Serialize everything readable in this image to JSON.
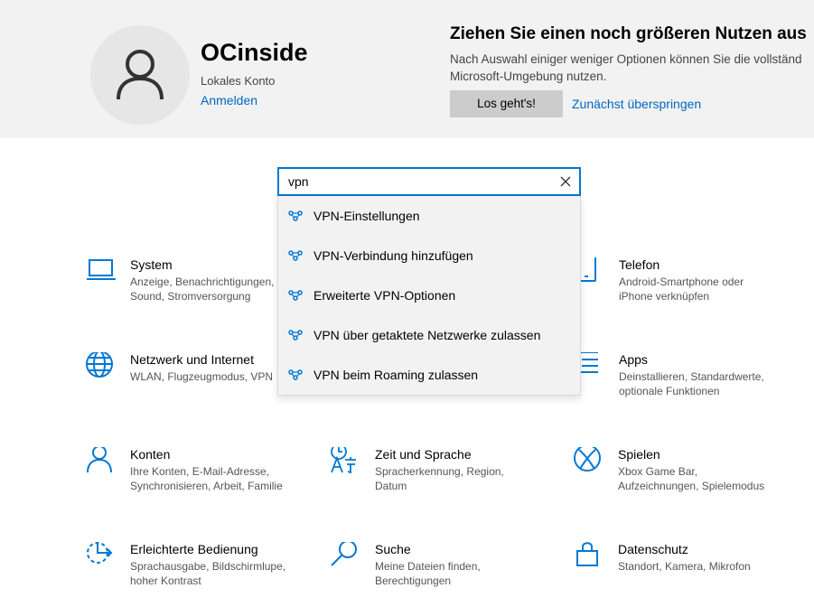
{
  "profile": {
    "name": "OCinside",
    "account_type": "Lokales Konto",
    "signin_label": "Anmelden"
  },
  "promo": {
    "title": "Ziehen Sie einen noch größeren Nutzen aus",
    "description_line1": "Nach Auswahl einiger weniger Optionen können Sie die vollständ",
    "description_line2": "Microsoft-Umgebung nutzen.",
    "button_label": "Los geht's!",
    "skip_label": "Zunächst überspringen"
  },
  "search": {
    "value": "vpn",
    "suggestions": [
      {
        "label": "VPN-Einstellungen"
      },
      {
        "label": "VPN-Verbindung hinzufügen"
      },
      {
        "label": "Erweiterte VPN-Optionen"
      },
      {
        "label": "VPN über getaktete Netzwerke zulassen"
      },
      {
        "label": "VPN beim Roaming zulassen"
      }
    ]
  },
  "categories": [
    {
      "title": "System",
      "desc1": "Anzeige, Benachrichtigungen,",
      "desc2": "Sound, Stromversorgung",
      "icon": "laptop-icon"
    },
    {
      "title": "Telefon",
      "desc1": "Android-Smartphone oder",
      "desc2": "iPhone verknüpfen",
      "icon": "phone-icon"
    },
    {
      "title": "Netzwerk und Internet",
      "desc1": "WLAN, Flugzeugmodus, VPN",
      "desc2": "",
      "icon": "globe-icon"
    },
    {
      "title": "Apps",
      "desc1": "Deinstallieren, Standardwerte,",
      "desc2": "optionale Funktionen",
      "icon": "apps-list-icon"
    },
    {
      "title": "Konten",
      "desc1": "Ihre Konten, E-Mail-Adresse,",
      "desc2": "Synchronisieren, Arbeit, Familie",
      "icon": "person-icon"
    },
    {
      "title": "Zeit und Sprache",
      "desc1": "Spracherkennung, Region,",
      "desc2": "Datum",
      "icon": "time-language-icon"
    },
    {
      "title": "Spielen",
      "desc1": "Xbox Game Bar,",
      "desc2": "Aufzeichnungen, Spielemodus",
      "icon": "xbox-icon"
    },
    {
      "title": "Erleichterte Bedienung",
      "desc1": "Sprachausgabe, Bildschirmlupe,",
      "desc2": "hoher Kontrast",
      "icon": "ease-of-access-icon"
    },
    {
      "title": "Suche",
      "desc1": "Meine Dateien finden,",
      "desc2": "Berechtigungen",
      "icon": "search-icon"
    },
    {
      "title": "Datenschutz",
      "desc1": "Standort, Kamera, Mikrofon",
      "desc2": "",
      "icon": "lock-icon"
    }
  ],
  "colors": {
    "accent": "#0078d4",
    "link": "#0067c0",
    "banner_bg": "#f2f2f2"
  }
}
